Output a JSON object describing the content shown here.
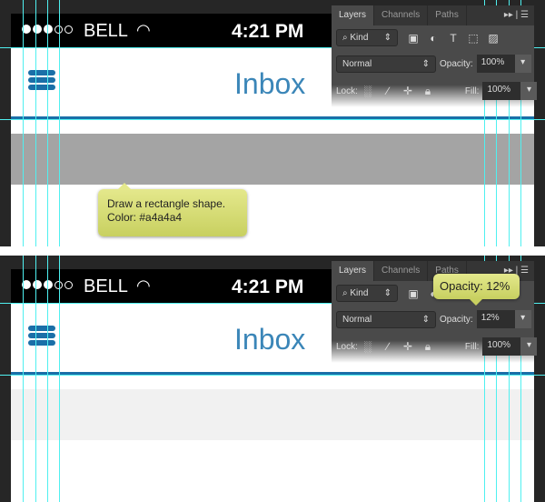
{
  "status": {
    "carrier": "BELL",
    "time": "4:21 PM",
    "signal_bars": 3,
    "signal_total": 5
  },
  "header": {
    "title": "Inbox"
  },
  "layers_panel": {
    "tabs": [
      "Layers",
      "Channels",
      "Paths"
    ],
    "filter": "Kind",
    "blend_mode": "Normal",
    "opacity_label": "Opacity:",
    "lock_label": "Lock:",
    "fill_label": "Fill:",
    "fill": "100%"
  },
  "step1": {
    "opacity": "100%",
    "rect_color": "#a4a4a4",
    "tooltip_line1": "Draw a rectangle shape.",
    "tooltip_line2": "Color: #a4a4a4"
  },
  "step2": {
    "opacity": "12%",
    "rect_color": "#f1f1f1",
    "tooltip": "Opacity: 12%"
  },
  "colors": {
    "accent": "#1a6fa8",
    "guide": "#4ff0f0"
  }
}
